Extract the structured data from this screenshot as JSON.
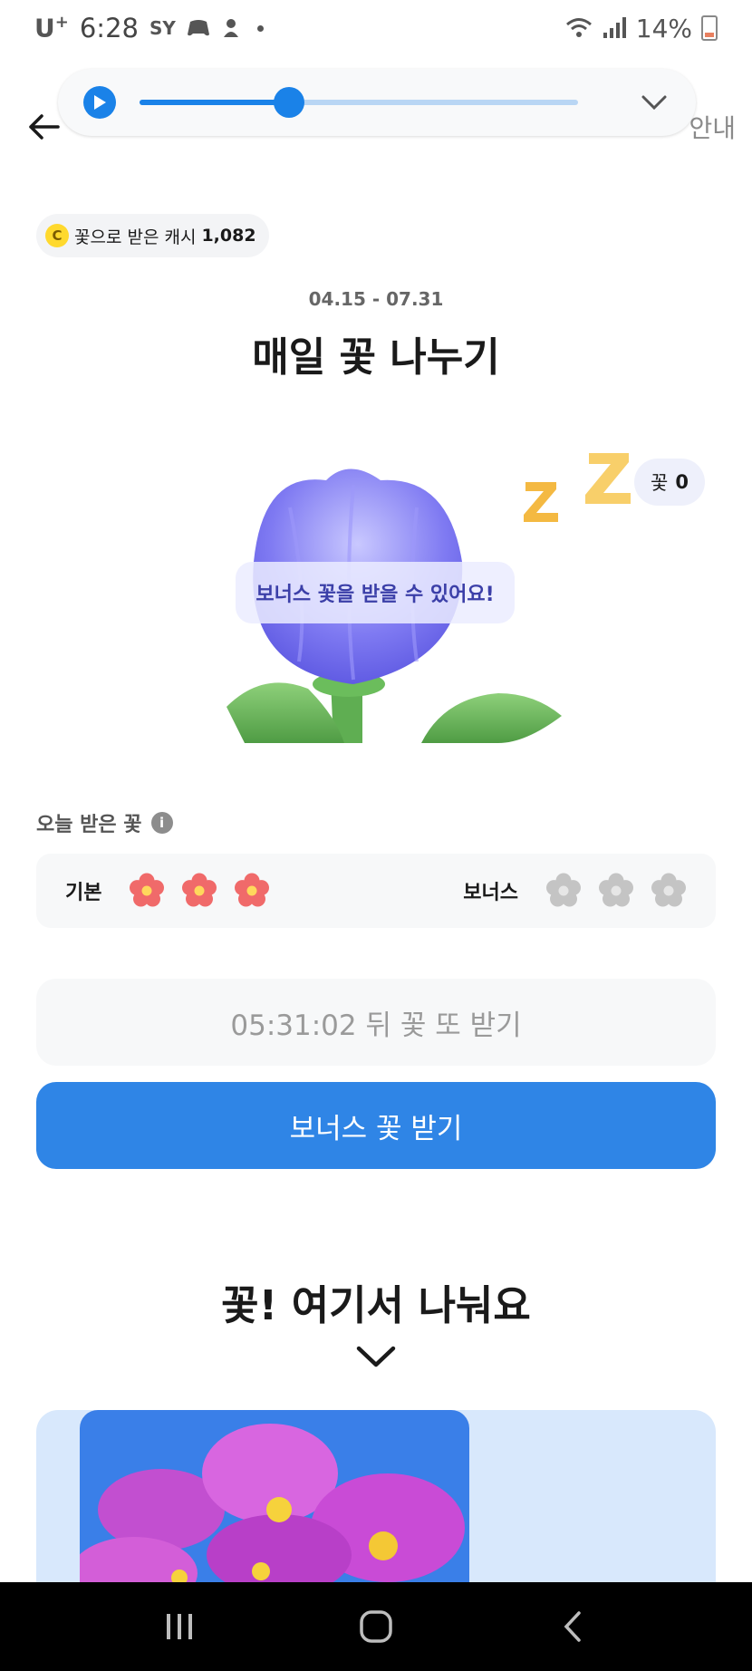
{
  "status_bar": {
    "carrier": "U",
    "carrier_sup": "+",
    "time": "6:28",
    "sy": "SY",
    "battery": "14%"
  },
  "header": {
    "guide": "안내",
    "media_progress": 0.34
  },
  "cash": {
    "coin": "C",
    "label": "꽃으로 받은 캐시",
    "value": "1,082"
  },
  "event": {
    "period": "04.15 - 07.31",
    "title": "매일 꽃 나누기"
  },
  "flower_status": {
    "count_label": "꽃",
    "count_value": "0",
    "bubble": "보너스 꽃을 받을 수 있어요!"
  },
  "today": {
    "label": "오늘 받은 꽃",
    "info": "i",
    "basic_label": "기본",
    "basic_received": 3,
    "bonus_label": "보너스",
    "bonus_received": 0
  },
  "buttons": {
    "countdown": "05:31:02 뒤 꽃 또 받기",
    "bonus": "보너스 꽃 받기"
  },
  "share": {
    "title": "꽃! 여기서 나눠요"
  },
  "colors": {
    "accent": "#2f85e6",
    "flower_active": "#f06a6a",
    "flower_inactive": "#c4c4c4"
  },
  "icons": {
    "back": "arrow-left-icon",
    "play": "play-icon",
    "collapse": "chevron-down-icon",
    "info": "info-icon",
    "nav_recent": "recent-apps-icon",
    "nav_home": "home-icon",
    "nav_back": "chevron-left-icon"
  }
}
